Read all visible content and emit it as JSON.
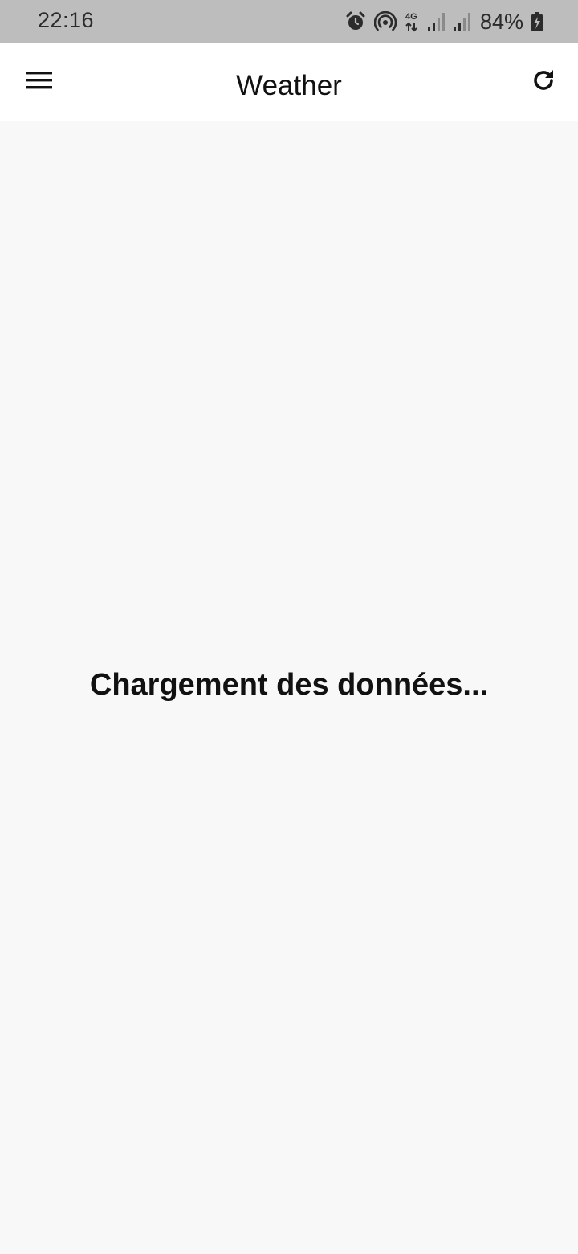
{
  "status_bar": {
    "time": "22:16",
    "network_label": "4G",
    "battery_percent": "84%",
    "icons": [
      "alarm-icon",
      "hotspot-icon",
      "network-4g-icon",
      "signal-icon",
      "signal-icon",
      "battery-charging-icon"
    ],
    "background": "#bdbdbd"
  },
  "app_bar": {
    "title": "Weather",
    "menu_icon": "hamburger-menu-icon",
    "refresh_icon": "refresh-icon"
  },
  "main": {
    "loading_message": "Chargement des données..."
  }
}
